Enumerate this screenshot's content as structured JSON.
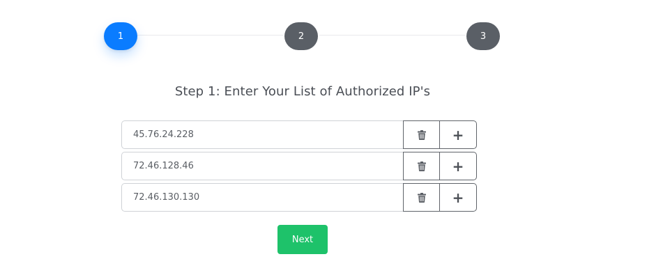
{
  "stepper": {
    "steps": [
      {
        "label": "1",
        "active": true
      },
      {
        "label": "2",
        "active": false
      },
      {
        "label": "3",
        "active": false
      }
    ]
  },
  "title": "Step 1: Enter Your List of Authorized IP's",
  "ip_rows": [
    {
      "value": "45.76.24.228"
    },
    {
      "value": "72.46.128.46"
    },
    {
      "value": "72.46.130.130"
    }
  ],
  "icons": {
    "delete": "trash-icon",
    "add": "plus-icon"
  },
  "buttons": {
    "add_label": "+",
    "next_label": "Next"
  },
  "colors": {
    "active_step": "#0a7cff",
    "inactive_step": "#5a5f66",
    "next_button": "#1ec26a"
  }
}
